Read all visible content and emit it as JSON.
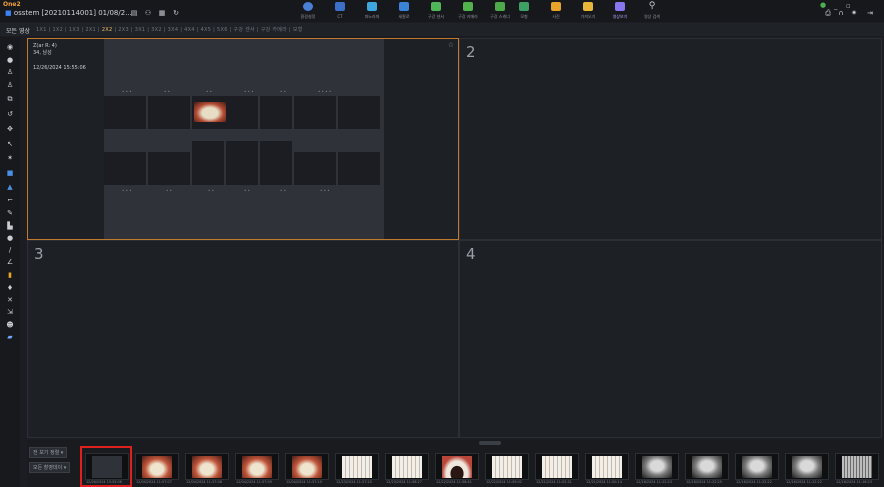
{
  "app": {
    "logo": "One2"
  },
  "titlebar": {
    "patient": "osstem  [20210114001] 01/08/2...",
    "nav": [
      {
        "label": "환경설정"
      },
      {
        "label": "CT"
      },
      {
        "label": "파노라마"
      },
      {
        "label": "세팔로"
      },
      {
        "label": "구강 센서"
      },
      {
        "label": "구강 카메라"
      },
      {
        "label": "구강 스캐너"
      },
      {
        "label": "모형"
      },
      {
        "label": "사진"
      },
      {
        "label": "가져오기"
      },
      {
        "label": "영상보기"
      },
      {
        "label": "영상 검색"
      }
    ]
  },
  "layoutbar": {
    "all_label": "모든 영상",
    "options_text": "1X1  |  1X2  |  1X3  |  2X1  |",
    "selected": "2X2",
    "options_rest": "|  2X3  |  3X1  |  3X2  |  3X4  |  4X4  |  4X5  |  5X6  |   구강 센서  |  구강 카메라  |  모형"
  },
  "viewer": {
    "cell1": {
      "patient_id": "Z(ar R: 4)",
      "patient_info": "34, 남성",
      "timestamp": "12/26/2024 15:55:06"
    },
    "cell2": {
      "number": "2"
    },
    "cell3": {
      "number": "3"
    },
    "cell4": {
      "number": "4"
    }
  },
  "filmstrip": {
    "btn1": "전 보기 정렬  ▾",
    "btn2": "모든 촬영데이  ▾",
    "thumbs": [
      {
        "label": "12/26/2024 15:55:06",
        "kind": "series"
      },
      {
        "label": "12/04/2024 11:57:07",
        "kind": "intraoral"
      },
      {
        "label": "12/04/2024 11:57:08",
        "kind": "intraoral"
      },
      {
        "label": "12/04/2024 11:57:09",
        "kind": "intraoral"
      },
      {
        "label": "12/04/2024 11:57:10",
        "kind": "intraoral"
      },
      {
        "label": "12/23/2024 11:57:20",
        "kind": "teeth"
      },
      {
        "label": "12/23/2024 11:58:27",
        "kind": "teeth"
      },
      {
        "label": "12/22/2024 11:58:41",
        "kind": "arch"
      },
      {
        "label": "12/22/2024 11:59:02",
        "kind": "teeth"
      },
      {
        "label": "12/21/2024 11:02:31",
        "kind": "teeth"
      },
      {
        "label": "12/21/2024 11:00:14",
        "kind": "teeth"
      },
      {
        "label": "12/16/2024 11:22:23",
        "kind": "xray"
      },
      {
        "label": "12/16/2024 11:22:25",
        "kind": "xray"
      },
      {
        "label": "12/16/2024 11:22:22",
        "kind": "xray"
      },
      {
        "label": "12/16/2024 11:22:22",
        "kind": "xray"
      },
      {
        "label": "12/16/2024 11:16:23",
        "kind": "pano"
      }
    ]
  },
  "colors": {
    "accent": "#f0c36a",
    "selection": "#e0201e",
    "active_nav": "#8a75f0"
  }
}
